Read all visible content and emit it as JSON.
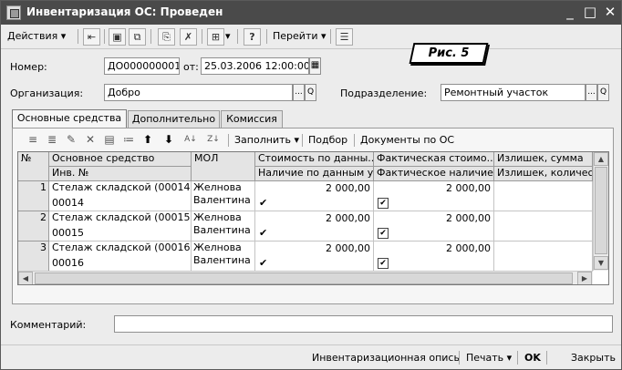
{
  "window": {
    "title": "Инвентаризация ОС: Проведен",
    "controls": {
      "minimize": "_",
      "maximize": "□",
      "close": "✕"
    }
  },
  "toolbar": {
    "actions_label": "Действия",
    "goto_label": "Перейти",
    "help_label": "?"
  },
  "annotation": {
    "label": "Рис. 5"
  },
  "header": {
    "number_label": "Номер:",
    "number_value": "ДО000000001",
    "date_label": "от:",
    "date_value": "25.03.2006 12:00:00",
    "org_label": "Организация:",
    "org_value": "Добро",
    "dept_label": "Подразделение:",
    "dept_value": "Ремонтный участок",
    "select_btn": "...",
    "open_btn": "Q"
  },
  "tabs": [
    {
      "label": "Основные средства"
    },
    {
      "label": "Дополнительно"
    },
    {
      "label": "Комиссия"
    }
  ],
  "table_toolbar": {
    "fill_label": "Заполнить",
    "select_label": "Подбор",
    "docs_label": "Документы по ОС"
  },
  "table": {
    "headers": {
      "num": "№",
      "asset": "Основное средство",
      "inv": "Инв. №",
      "mol": "МОЛ",
      "cost_data": "Стоимость по данны...",
      "presence_data": "Наличие по данным у...",
      "cost_fact": "Фактическая стоимо...",
      "presence_fact": "Фактическое наличие",
      "surplus_sum": "Излишек, сумма",
      "surplus_qty": "Излишек, количест"
    },
    "rows": [
      {
        "num": "1",
        "asset": "Стелаж складской (00014)",
        "inv": "00014",
        "mol1": "Желнова",
        "mol2": "Валентина",
        "cost_data": "2 000,00",
        "cost_fact": "2 000,00"
      },
      {
        "num": "2",
        "asset": "Стелаж складской (00015)",
        "inv": "00015",
        "mol1": "Желнова",
        "mol2": "Валентина",
        "cost_data": "2 000,00",
        "cost_fact": "2 000,00"
      },
      {
        "num": "3",
        "asset": "Стелаж складской (00016)",
        "inv": "00016",
        "mol1": "Желнова",
        "mol2": "Валентина",
        "cost_data": "2 000,00",
        "cost_fact": "2 000,00"
      }
    ],
    "check_mark": "✔"
  },
  "comment": {
    "label": "Комментарий:",
    "value": ""
  },
  "footer": {
    "inventory_list": "Инвентаризационная опись",
    "print_label": "Печать",
    "ok_label": "OK",
    "close_label": "Закрыть"
  }
}
